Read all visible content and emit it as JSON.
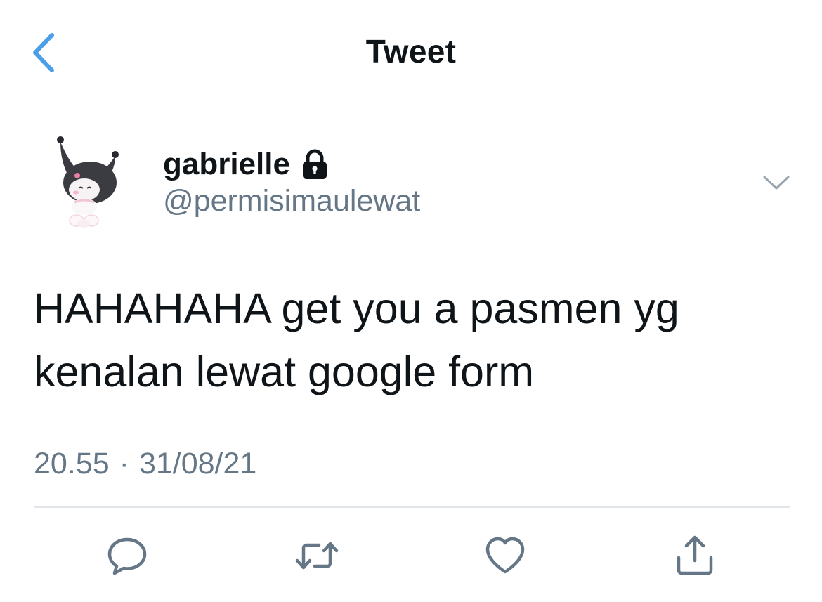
{
  "header": {
    "title": "Tweet",
    "back_icon": "chevron-left-icon",
    "accent_color": "#4a9fe8"
  },
  "tweet": {
    "author": {
      "display_name": "gabrielle",
      "handle": "@permisimaulewat",
      "protected_icon": "lock-icon",
      "avatar": "kuromi-avatar"
    },
    "text_lines": [
      "HAHAHAHA get you a pasmen yg",
      "kenalan lewat google form"
    ],
    "time": "20.55",
    "separator": "·",
    "date": "31/08/21",
    "more_icon": "chevron-down-icon"
  },
  "actions": [
    {
      "name": "reply",
      "icon": "reply-icon"
    },
    {
      "name": "retweet",
      "icon": "retweet-icon"
    },
    {
      "name": "like",
      "icon": "heart-icon"
    },
    {
      "name": "share",
      "icon": "share-icon"
    }
  ],
  "colors": {
    "text_primary": "#0f1419",
    "text_secondary": "#657786",
    "divider": "#e1e4e8",
    "action_icon": "#657786"
  }
}
